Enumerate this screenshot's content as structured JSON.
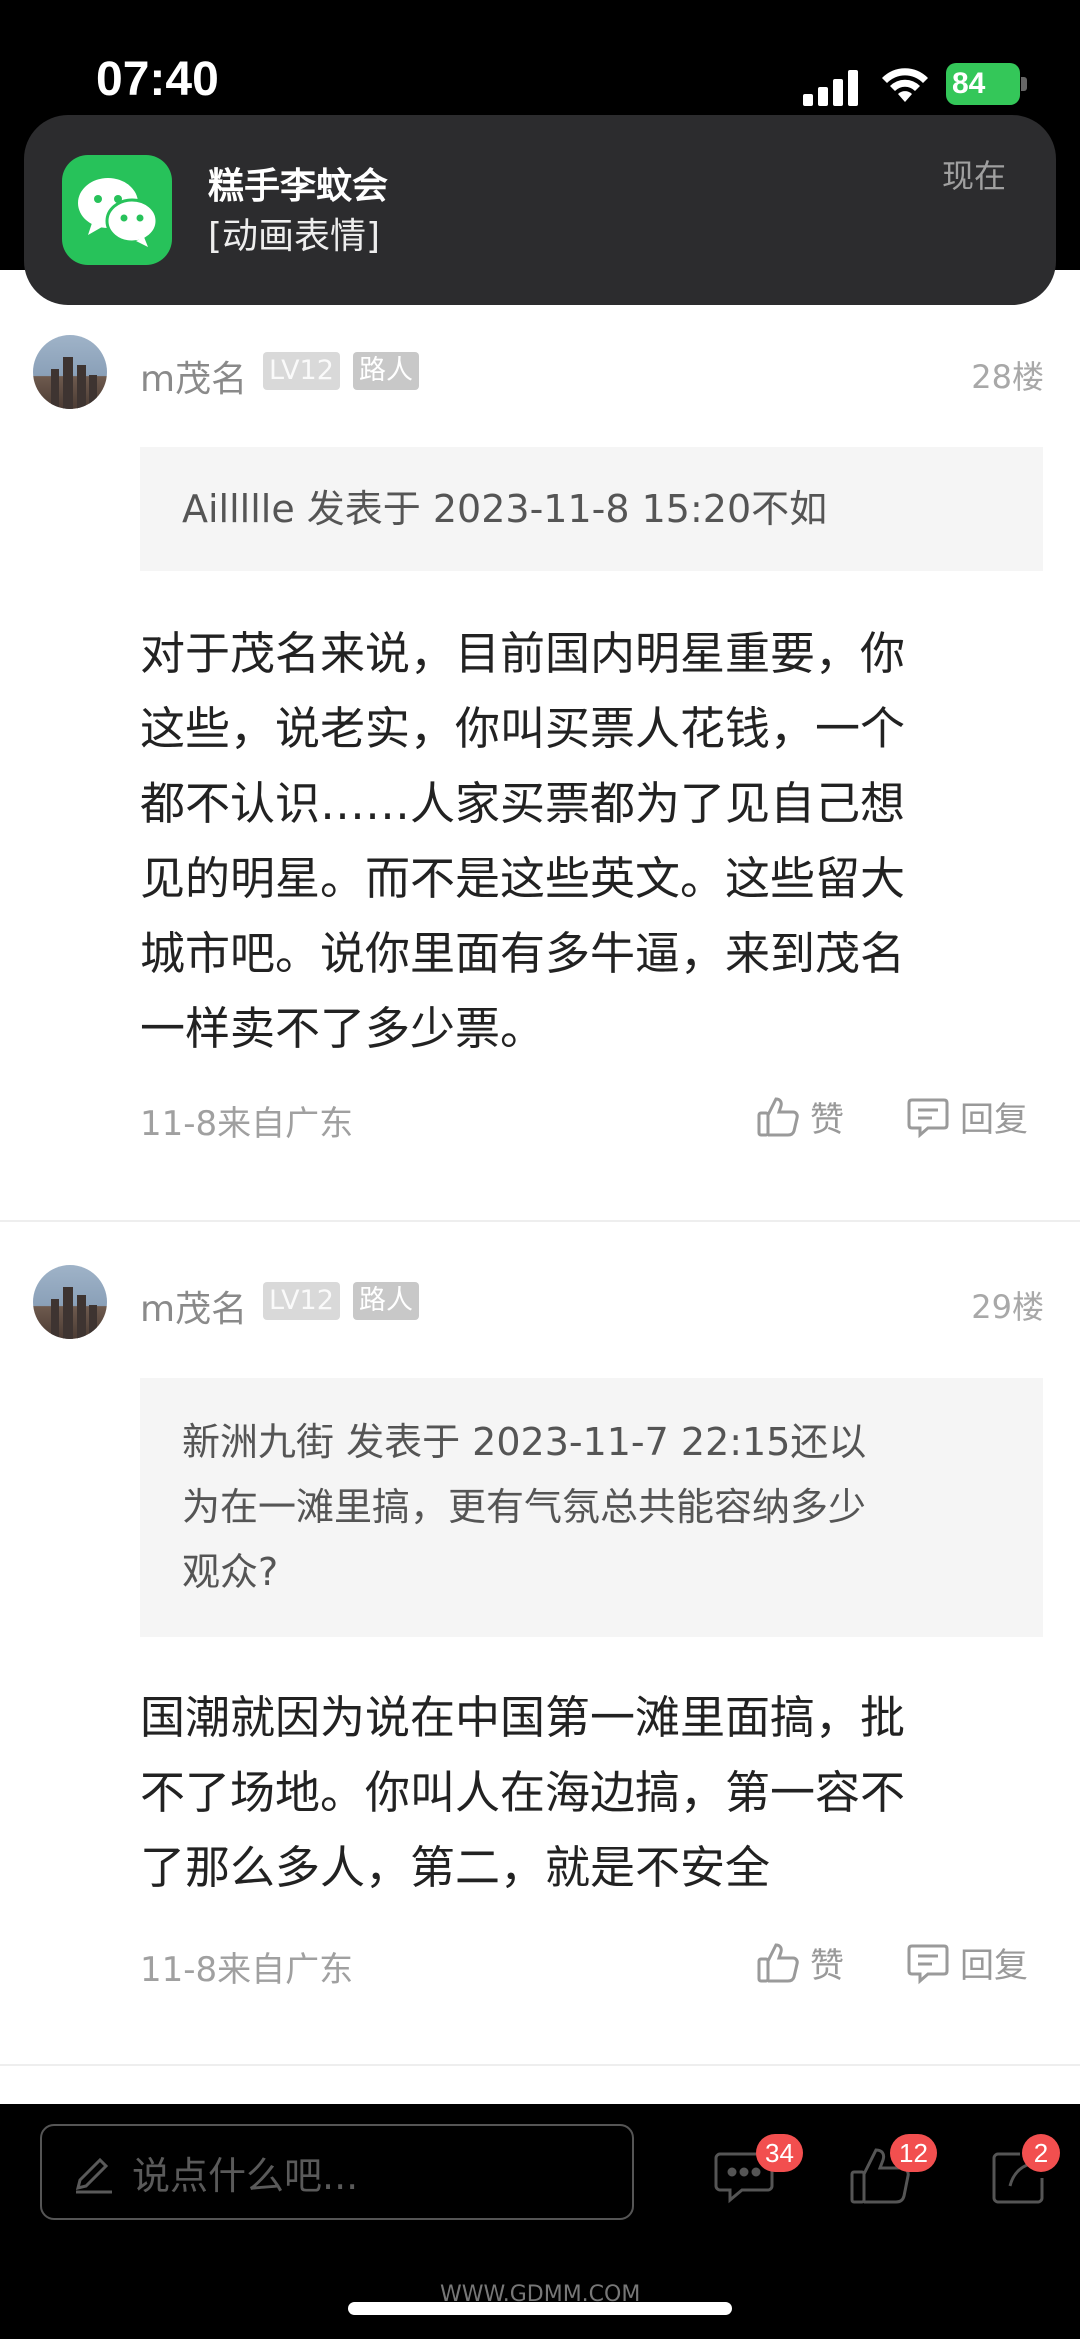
{
  "status_bar": {
    "time": "07:40",
    "battery": "84"
  },
  "notification": {
    "app_icon": "wechat-icon",
    "title": "糕手李蚊会",
    "body": "[动画表情]",
    "time": "现在"
  },
  "posts": [
    {
      "username": "m茂名",
      "level": "LV12",
      "role": "路人",
      "floor": "28楼",
      "quote": "Aillllle 发表于 2023-11-8 15:20不如",
      "content_lines": [
        "对于茂名来说，目前国内明星重要，你",
        "这些，说老实，你叫买票人花钱，一个",
        "都不认识……人家买票都为了见自己想",
        "见的明星。而不是这些英文。这些留大",
        "城市吧。说你里面有多牛逼，来到茂名",
        "一样卖不了多少票。"
      ],
      "meta": "11-8来自广东",
      "like_label": "赞",
      "reply_label": "回复"
    },
    {
      "username": "m茂名",
      "level": "LV12",
      "role": "路人",
      "floor": "29楼",
      "quote_lines": [
        "新洲九街 发表于 2023-11-7 22:15还以",
        "为在一滩里搞，更有气氛总共能容纳多少",
        "观众?"
      ],
      "content_lines": [
        "国潮就因为说在中国第一滩里面搞，批",
        "不了场地。你叫人在海边搞，第一容不",
        "了那么多人，第二，就是不安全"
      ],
      "meta": "11-8来自广东",
      "like_label": "赞",
      "reply_label": "回复"
    }
  ],
  "bottom_bar": {
    "input_placeholder": "说点什么吧...",
    "comment_count": "34",
    "like_count": "12",
    "share_count": "2"
  },
  "watermark": "WWW.GDMM.COM",
  "icons": {
    "like": "thumbs-up-icon",
    "reply": "comment-icon",
    "edit": "pencil-icon",
    "share": "share-icon"
  }
}
